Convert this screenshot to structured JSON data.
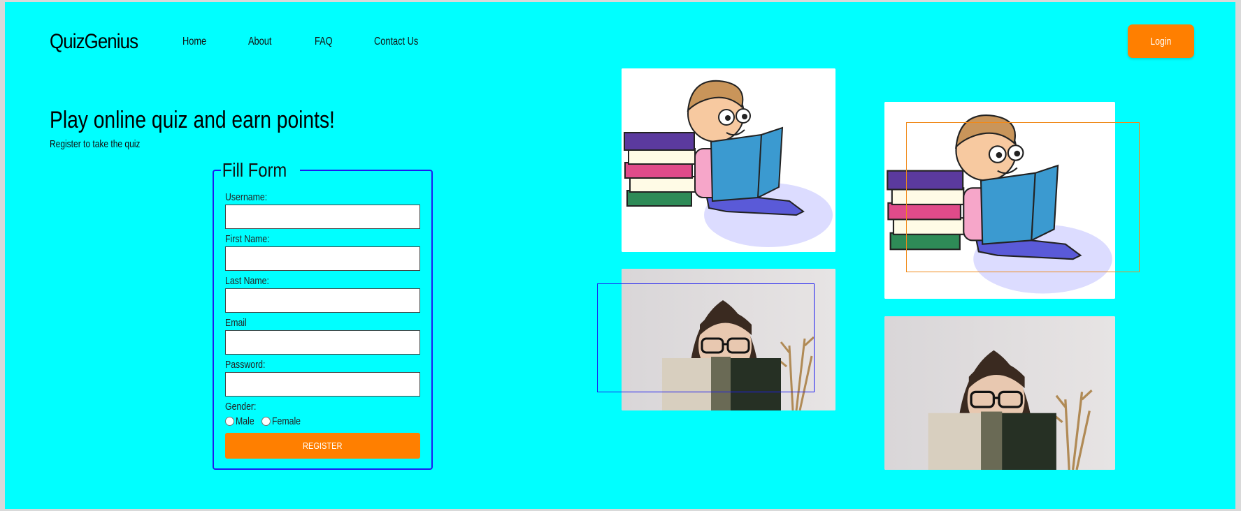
{
  "header": {
    "brand": "QuizGenius",
    "nav": [
      "Home",
      "About",
      "FAQ",
      "Contact Us"
    ],
    "login_label": "Login"
  },
  "hero": {
    "title": "Play online quiz and earn points!",
    "subtitle": "Register to take the quiz"
  },
  "form": {
    "legend": "Fill Form",
    "fields": [
      "Username:",
      "First Name:",
      "Last Name:",
      "Email",
      "Password:"
    ],
    "gender_label": "Gender:",
    "gender_options": [
      "Male",
      "Female"
    ],
    "register_label": "REGISTER"
  },
  "colors": {
    "page_bg": "#00ffff",
    "accent": "#ff7f00",
    "form_border": "#1c1cf0"
  }
}
